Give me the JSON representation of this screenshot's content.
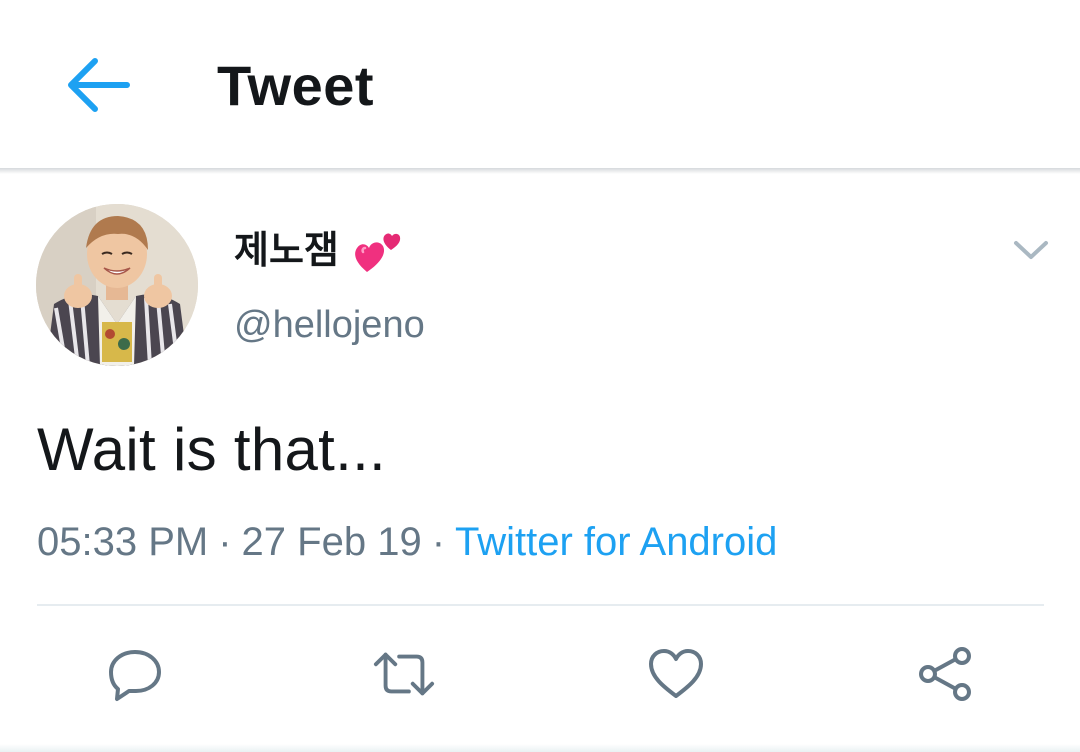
{
  "header": {
    "title": "Tweet",
    "back_icon": "arrow-left-icon"
  },
  "tweet": {
    "author": {
      "display_name": "제노잼",
      "emoji": "two-hearts-emoji",
      "handle": "@hellojeno"
    },
    "text": "Wait is that...",
    "time": "05:33 PM",
    "separator": "·",
    "date": "27 Feb 19",
    "source": "Twitter for Android"
  },
  "actions": [
    "reply-icon",
    "retweet-icon",
    "like-icon",
    "share-icon"
  ],
  "colors": {
    "accent": "#1da1f2",
    "text_primary": "#14171a",
    "text_secondary": "#657786",
    "icon_gray": "#657786",
    "divider": "#e6ecf0"
  }
}
